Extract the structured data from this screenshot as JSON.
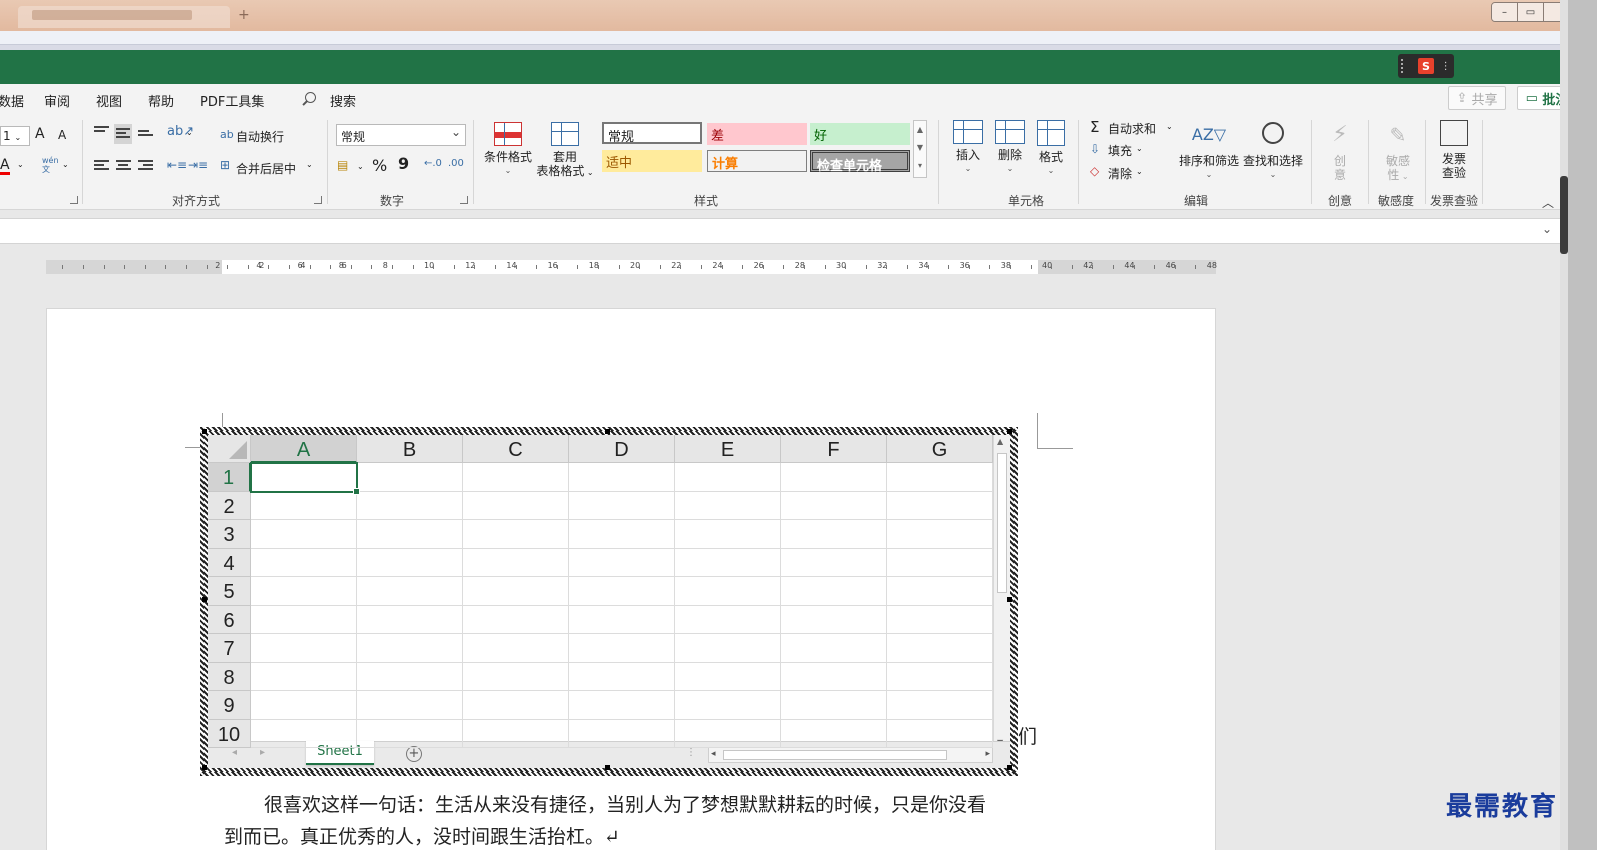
{
  "window": {
    "new_tab": "+",
    "controls": {
      "minimize": "–",
      "restore": "▭",
      "close": "✕"
    }
  },
  "ime_logo": "S",
  "menu": {
    "items": [
      "数据",
      "审阅",
      "视图",
      "帮助",
      "PDF工具集"
    ],
    "search_label": "搜索",
    "share_label": "共享",
    "comment_label": "批注"
  },
  "ribbon": {
    "font": {
      "size_value": "1",
      "grow": "A",
      "shrink": "A",
      "color": "A",
      "phonetic": "wén"
    },
    "alignment": {
      "wrap": "自动换行",
      "merge": "合并后居中",
      "label": "对齐方式"
    },
    "number": {
      "format_value": "常规",
      "percent": "%",
      "comma": "9",
      "label": "数字"
    },
    "styles": {
      "cond_format": "条件格式",
      "table_format_1": "套用",
      "table_format_2": "表格格式",
      "cells": [
        "常规",
        "差",
        "好",
        "适中",
        "计算",
        "检查单元格"
      ],
      "label": "样式"
    },
    "cells_group": {
      "insert": "插入",
      "delete": "删除",
      "format": "格式",
      "label": "单元格"
    },
    "editing": {
      "autosum": "自动求和",
      "fill": "填充",
      "clear": "清除",
      "sort": "排序和筛选",
      "find": "查找和选择",
      "label": "编辑"
    },
    "creative": {
      "button_1": "创",
      "button_2": "意",
      "label": "创意"
    },
    "sensitivity": {
      "button_1": "敏感",
      "button_2": "性",
      "label": "敏感度"
    },
    "invoice": {
      "button_1": "发票",
      "button_2": "查验",
      "label": "发票查验"
    }
  },
  "ruler": {
    "left_numbers": [
      "8",
      "6",
      "4",
      "2"
    ],
    "numbers": [
      "2",
      "4",
      "6",
      "8",
      "10",
      "12",
      "14",
      "16",
      "18",
      "20",
      "22",
      "24",
      "26",
      "28",
      "30",
      "32",
      "34",
      "36",
      "38",
      "40",
      "42",
      "44",
      "46",
      "48"
    ]
  },
  "sheet": {
    "columns": [
      "A",
      "B",
      "C",
      "D",
      "E",
      "F",
      "G"
    ],
    "rows": [
      "1",
      "2",
      "3",
      "4",
      "5",
      "6",
      "7",
      "8",
      "9",
      "10"
    ],
    "active_cell": "A1",
    "tab_name": "Sheet1",
    "add_sheet": "+"
  },
  "document": {
    "line_edge": "们",
    "paragraph_line1": "很喜欢这样一句话：生活从来没有捷径，当别人为了梦想默默耕耘的时候，只是你没看",
    "paragraph_line2": "到而已。真正优秀的人，没时间跟生活抬杠。↵"
  },
  "watermark": "最需教育",
  "colors": {
    "excel_green": "#217346",
    "title_bar": "#e2b99f"
  }
}
